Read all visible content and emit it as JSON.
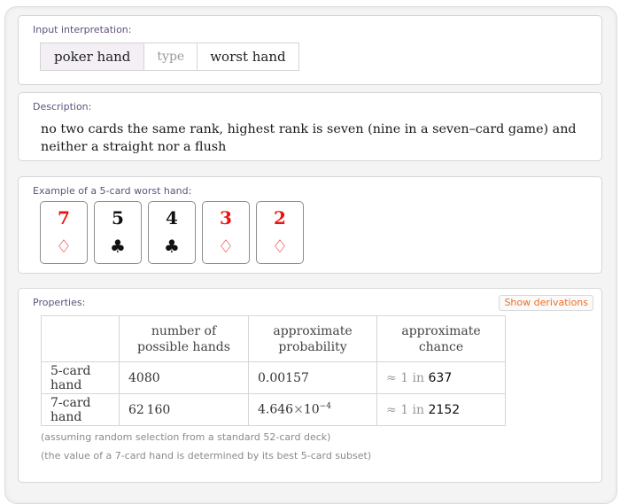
{
  "input_interpretation": {
    "title": "Input interpretation:",
    "cells": [
      "poker hand",
      "type",
      "worst hand"
    ]
  },
  "description": {
    "title": "Description:",
    "text": "no two cards the same rank, highest rank is seven (nine in a seven–card game) and neither a straight nor a flush"
  },
  "example": {
    "title": "Example of a 5-card worst hand:",
    "cards": [
      {
        "rank": "7",
        "suit": "♢",
        "suit_name": "diamond-icon",
        "color": "#ee1111"
      },
      {
        "rank": "5",
        "suit": "♣",
        "suit_name": "club-icon",
        "color": "#111111"
      },
      {
        "rank": "4",
        "suit": "♣",
        "suit_name": "club-icon",
        "color": "#111111"
      },
      {
        "rank": "3",
        "suit": "♢",
        "suit_name": "diamond-icon",
        "color": "#ee1111"
      },
      {
        "rank": "2",
        "suit": "♢",
        "suit_name": "diamond-icon",
        "color": "#ee1111"
      }
    ]
  },
  "properties": {
    "title": "Properties:",
    "show_derivations": "Show derivations",
    "headers": [
      "",
      "number of possible hands",
      "approximate probability",
      "approximate chance"
    ],
    "rows": [
      {
        "label": "5-card hand",
        "count": "4080",
        "probability": "0.00157",
        "prob_exp": "",
        "approx": "≈",
        "one_in": "1 in",
        "chance": "637"
      },
      {
        "label": "7-card hand",
        "count": "62 160",
        "probability": "4.646",
        "times": "×",
        "base": "10",
        "prob_exp": "−4",
        "approx": "≈",
        "one_in": "1 in",
        "chance": "2152"
      }
    ],
    "notes": [
      "(assuming random selection from a standard 52-card deck)",
      "(the value of a 7-card hand is determined by its best 5-card subset)"
    ]
  }
}
